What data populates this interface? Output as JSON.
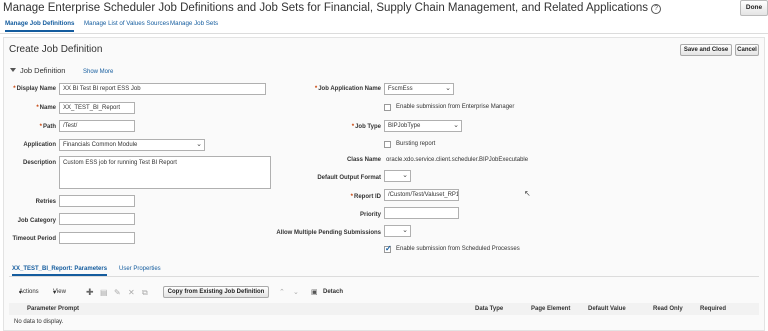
{
  "header": {
    "title": "Manage Enterprise Scheduler Job Definitions and Job Sets for Financial, Supply Chain Management, and Related Applications",
    "help": "?",
    "done_label": "Done"
  },
  "topnav": {
    "items": [
      "Manage Job Definitions",
      "Manage List of Values Sources",
      "Manage Job Sets"
    ]
  },
  "page": {
    "title": "Create Job Definition",
    "save_close_label": "Save and Close",
    "cancel_label": "Cancel"
  },
  "section": {
    "title": "Job Definition",
    "show_more": "Show More"
  },
  "form": {
    "display_name": {
      "label": "Display Name",
      "value": "XX BI Test BI report ESS Job"
    },
    "name": {
      "label": "Name",
      "value": "XX_TEST_BI_Report"
    },
    "path": {
      "label": "Path",
      "value": "/Test/"
    },
    "application": {
      "label": "Application",
      "value": "Financials Common Module"
    },
    "description": {
      "label": "Description",
      "value": "Custom ESS job for running Test BI Report"
    },
    "retries": {
      "label": "Retries",
      "value": ""
    },
    "job_category": {
      "label": "Job Category",
      "value": ""
    },
    "timeout_period": {
      "label": "Timeout Period",
      "value": ""
    },
    "job_app_name": {
      "label": "Job Application Name",
      "value": "FscmEss"
    },
    "enable_em": {
      "label": "Enable submission from Enterprise Manager"
    },
    "job_type": {
      "label": "Job Type",
      "value": "BIPJobType"
    },
    "bursting": {
      "label": "Bursting report"
    },
    "class_name": {
      "label": "Class Name",
      "value": "oracle.xdo.service.client.scheduler.BIPJobExecutable"
    },
    "default_output": {
      "label": "Default Output Format",
      "value": ""
    },
    "report_id": {
      "label": "Report ID",
      "value": "/Custom/Test/Valuset_RP1"
    },
    "priority": {
      "label": "Priority",
      "value": ""
    },
    "allow_multiple": {
      "label": "Allow Multiple Pending Submissions",
      "value": ""
    },
    "enable_sched": {
      "label": "Enable submission from Scheduled Processes",
      "checked": true
    }
  },
  "lower_tabs": {
    "params": "XX_TEST_BI_Report: Parameters",
    "user_props": "User Properties"
  },
  "toolbar": {
    "actions": "Actions",
    "view": "View",
    "copy": "Copy from Existing Job Definition",
    "detach": "Detach"
  },
  "table": {
    "headers": [
      "Parameter Prompt",
      "Data Type",
      "Page Element",
      "Default Value",
      "Read Only",
      "Required"
    ],
    "empty": "No data to display."
  }
}
